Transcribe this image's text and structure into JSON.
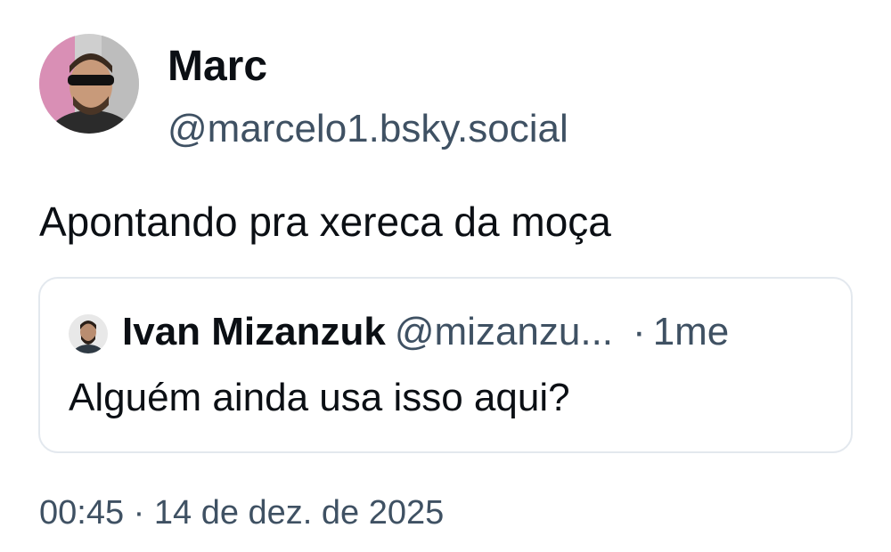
{
  "post": {
    "author": {
      "display_name": "Marc",
      "handle": "@marcelo1.bsky.social"
    },
    "text": "Apontando pra xereca da moça",
    "quote": {
      "author_name": "Ivan Mizanzuk",
      "author_handle": "@mizanzu...",
      "separator": "·",
      "time": "1me",
      "text": "Alguém ainda usa isso aqui?"
    },
    "timestamp": "00:45 · 14 de dez. de 2025"
  },
  "colors": {
    "text_primary": "#0b0f14",
    "text_secondary": "#3f5163",
    "card_border": "#e3e8ee",
    "background": "#ffffff"
  },
  "icons": {
    "author_avatar": "avatar-photo",
    "quote_avatar": "avatar-photo"
  }
}
